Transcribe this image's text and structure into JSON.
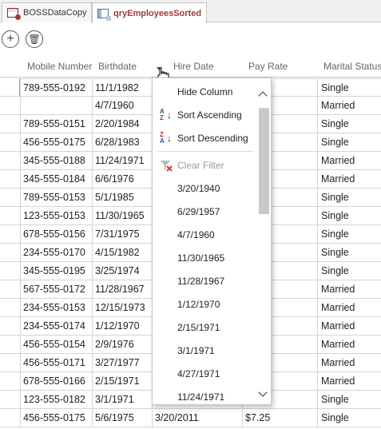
{
  "tabs": [
    {
      "label": "BOSSDataCopy",
      "active": false
    },
    {
      "label": "qryEmployeesSorted",
      "active": true
    }
  ],
  "toolbar": {
    "add_label": "+",
    "delete_label": "🗑"
  },
  "columns": [
    "Mobile Number",
    "Birthdate",
    "Hire Date",
    "Pay Rate",
    "Marital Status"
  ],
  "rows": [
    {
      "mobile": "789-555-0192",
      "birthdate": "11/1/1982",
      "hire": "",
      "pay": "",
      "marital": "Single"
    },
    {
      "mobile": "",
      "birthdate": "4/7/1960",
      "hire": "",
      "pay": "",
      "marital": "Married"
    },
    {
      "mobile": "789-555-0151",
      "birthdate": "2/20/1984",
      "hire": "",
      "pay": "",
      "marital": "Single"
    },
    {
      "mobile": "456-555-0175",
      "birthdate": "6/28/1983",
      "hire": "",
      "pay": "",
      "marital": "Single"
    },
    {
      "mobile": "345-555-0188",
      "birthdate": "11/24/1971",
      "hire": "",
      "pay": "",
      "marital": "Married"
    },
    {
      "mobile": "345-555-0184",
      "birthdate": "6/6/1976",
      "hire": "",
      "pay": "",
      "marital": "Married"
    },
    {
      "mobile": "789-555-0153",
      "birthdate": "5/1/1985",
      "hire": "",
      "pay": "",
      "marital": "Single"
    },
    {
      "mobile": "123-555-0153",
      "birthdate": "11/30/1965",
      "hire": "",
      "pay": "",
      "marital": "Single"
    },
    {
      "mobile": "678-555-0156",
      "birthdate": "7/31/1975",
      "hire": "",
      "pay": "",
      "marital": "Single"
    },
    {
      "mobile": "234-555-0170",
      "birthdate": "4/15/1982",
      "hire": "",
      "pay": "",
      "marital": "Single"
    },
    {
      "mobile": "345-555-0195",
      "birthdate": "3/25/1974",
      "hire": "",
      "pay": "",
      "marital": "Single"
    },
    {
      "mobile": "567-555-0172",
      "birthdate": "11/28/1967",
      "hire": "",
      "pay": "",
      "marital": "Married"
    },
    {
      "mobile": "234-555-0153",
      "birthdate": "12/15/1973",
      "hire": "",
      "pay": "",
      "marital": "Married"
    },
    {
      "mobile": "234-555-0174",
      "birthdate": "1/12/1970",
      "hire": "",
      "pay": "",
      "marital": "Married"
    },
    {
      "mobile": "456-555-0154",
      "birthdate": "2/9/1976",
      "hire": "",
      "pay": "",
      "marital": "Married"
    },
    {
      "mobile": "456-555-0171",
      "birthdate": "3/27/1977",
      "hire": "",
      "pay": "",
      "marital": "Married"
    },
    {
      "mobile": "678-555-0166",
      "birthdate": "2/15/1971",
      "hire": "",
      "pay": "",
      "marital": "Married"
    },
    {
      "mobile": "123-555-0182",
      "birthdate": "3/1/1971",
      "hire": "",
      "pay": "",
      "marital": "Single"
    },
    {
      "mobile": "456-555-0175",
      "birthdate": "5/6/1975",
      "hire": "3/20/2011",
      "pay": "$7.25",
      "marital": "Single"
    }
  ],
  "menu": {
    "hide_column": "Hide Column",
    "sort_ascending": "Sort Ascending",
    "sort_descending": "Sort Descending",
    "clear_filter": "Clear Filter",
    "values": [
      "3/20/1940",
      "6/29/1957",
      "4/7/1960",
      "11/30/1965",
      "11/28/1967",
      "1/12/1970",
      "2/15/1971",
      "3/1/1971",
      "4/27/1971",
      "11/24/1971"
    ]
  },
  "colors": {
    "accent": "#a4373a",
    "gridline": "#d4d4d4",
    "header_text": "#666666"
  }
}
